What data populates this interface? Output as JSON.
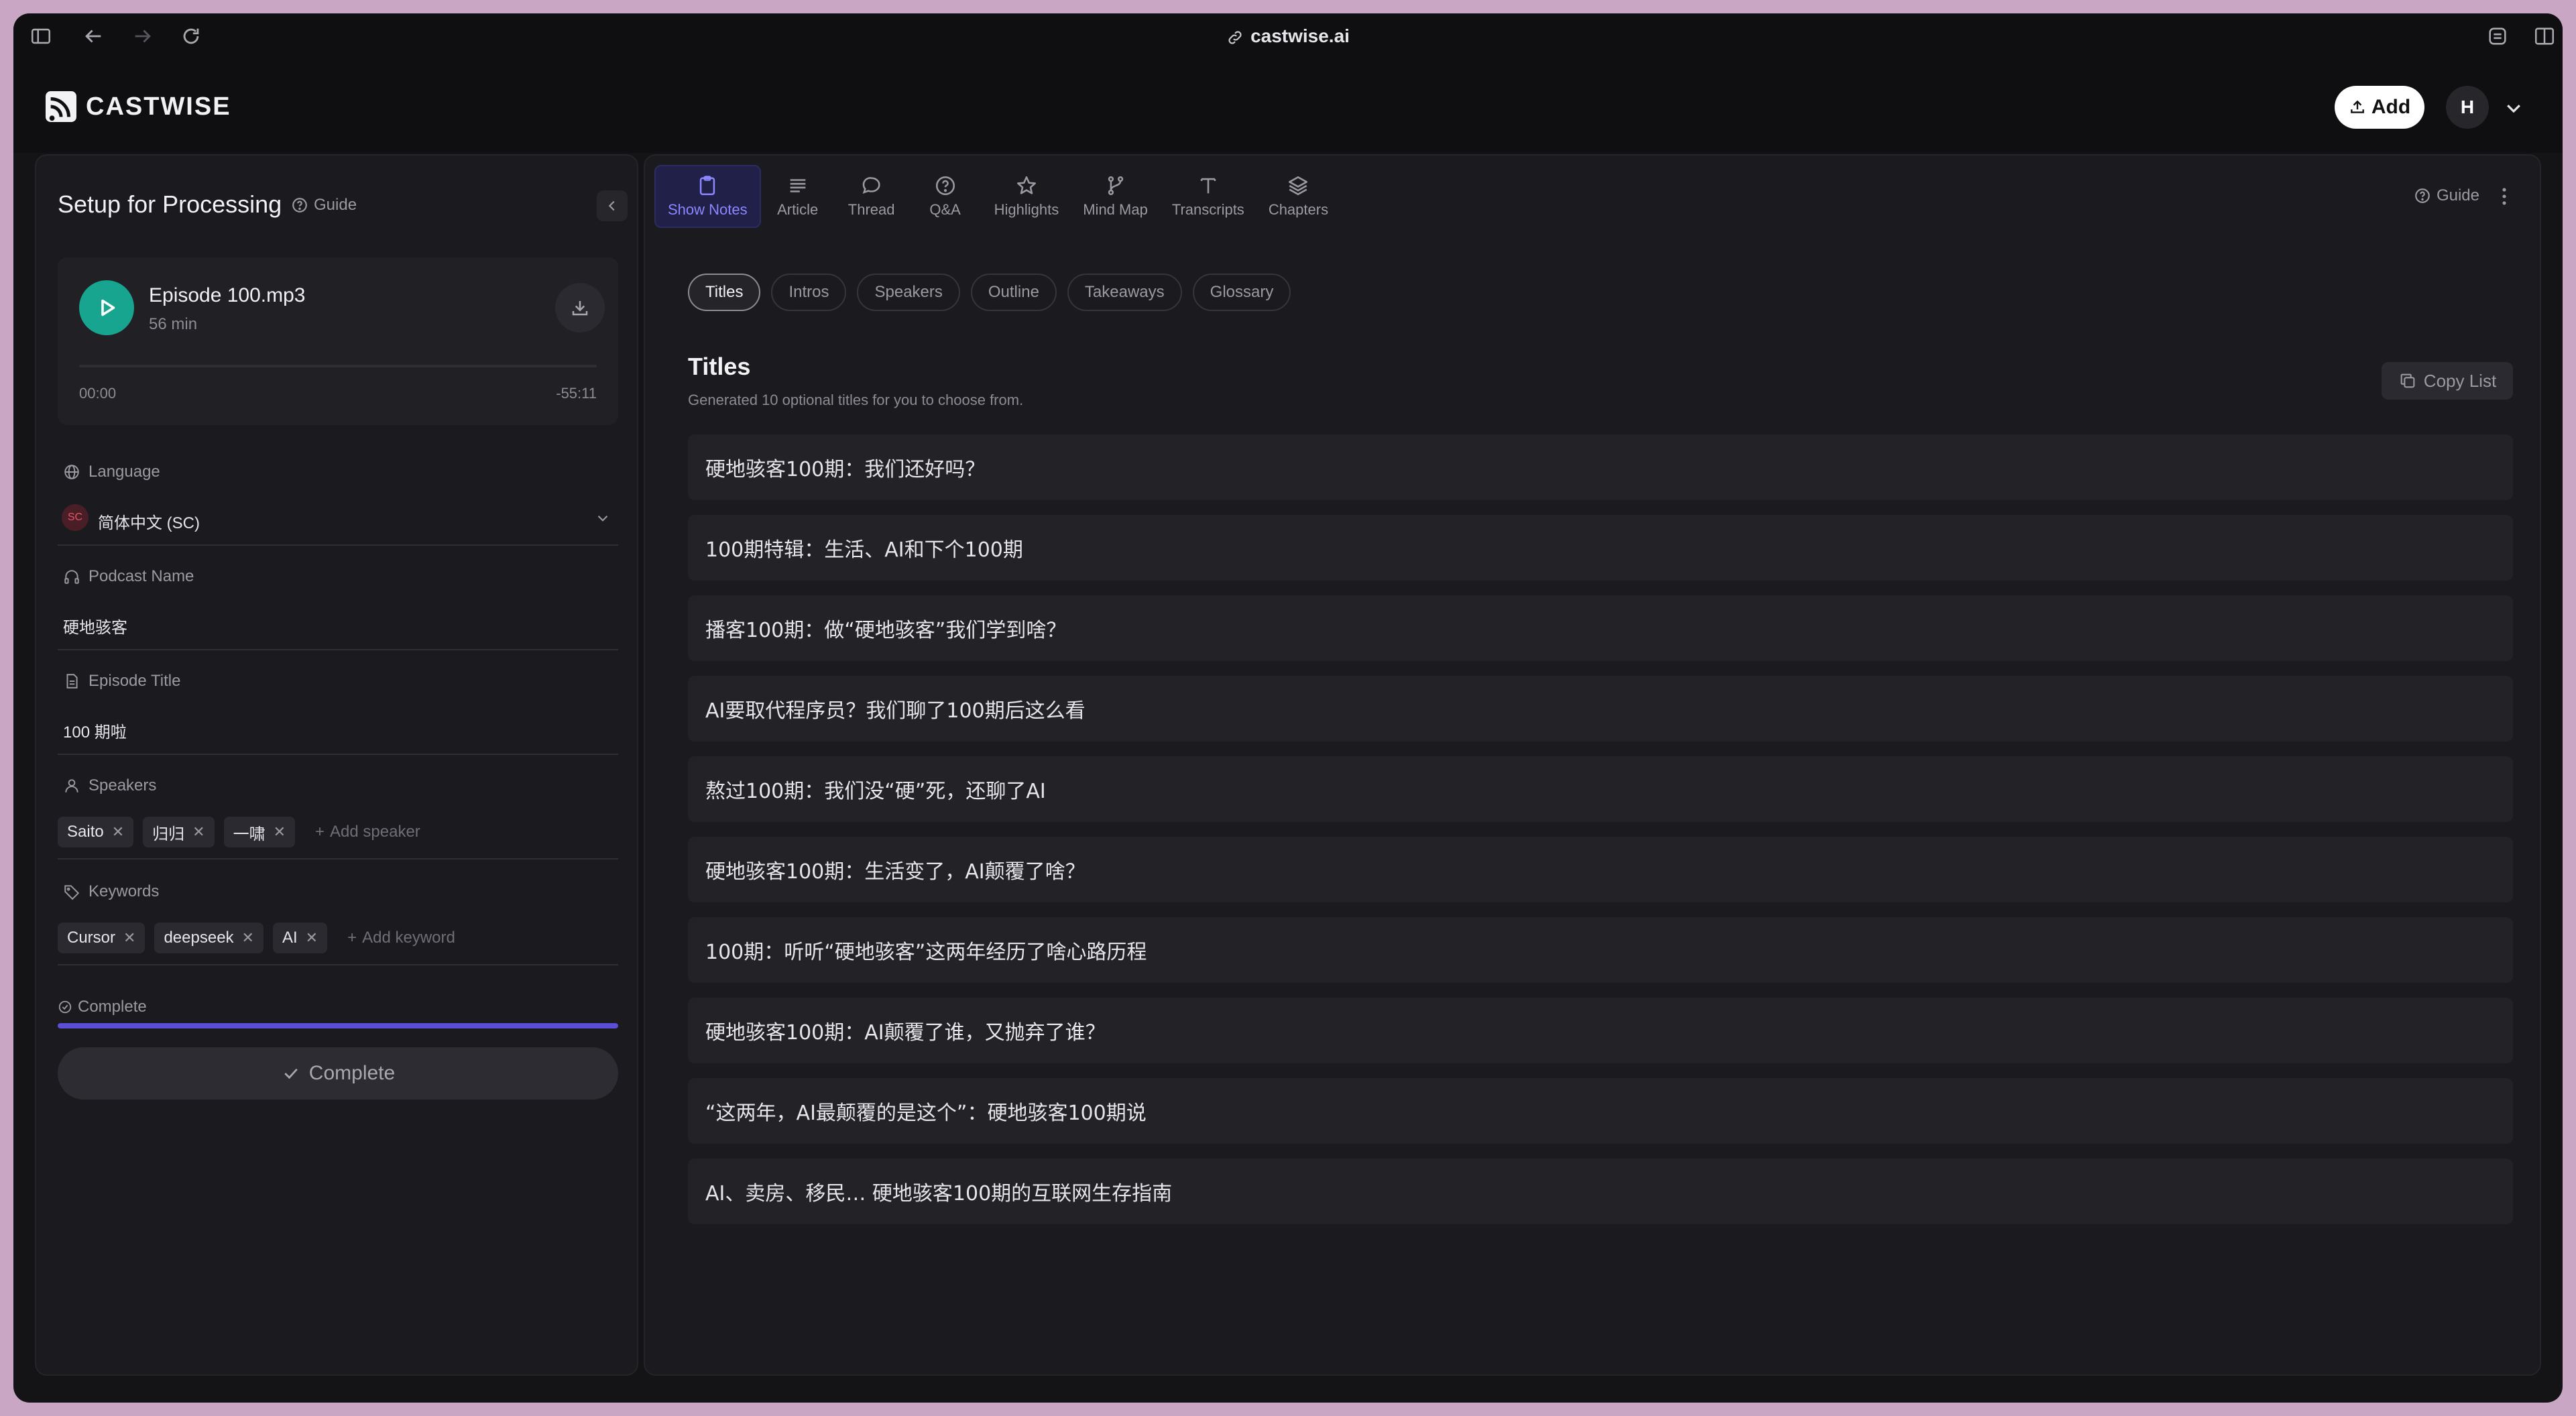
{
  "browser": {
    "url": "castwise.ai"
  },
  "header": {
    "logo_text": "CASTWISE",
    "add_label": "Add",
    "avatar_initial": "H"
  },
  "setup": {
    "title": "Setup for Processing",
    "guide_label": "Guide",
    "player": {
      "file_name": "Episode 100.mp3",
      "duration": "56 min",
      "time_start": "00:00",
      "time_end": "-55:11"
    },
    "language": {
      "label": "Language",
      "badge": "SC",
      "value": "简体中文 (SC)"
    },
    "podcast_name": {
      "label": "Podcast Name",
      "value": "硬地骇客"
    },
    "episode_title": {
      "label": "Episode Title",
      "value": "100 期啦"
    },
    "speakers": {
      "label": "Speakers",
      "items": [
        "Saito",
        "归归",
        "一啸"
      ],
      "add_label": "Add speaker"
    },
    "keywords": {
      "label": "Keywords",
      "items": [
        "Cursor",
        "deepseek",
        "AI"
      ],
      "add_label": "Add keyword"
    },
    "complete": {
      "label": "Complete",
      "progress": 1.0,
      "button_label": "Complete"
    }
  },
  "main": {
    "tabs": [
      {
        "label": "Show Notes",
        "icon": "clipboard-icon"
      },
      {
        "label": "Article",
        "icon": "lines-icon"
      },
      {
        "label": "Thread",
        "icon": "chat-bubble-icon"
      },
      {
        "label": "Q&A",
        "icon": "question-icon"
      },
      {
        "label": "Highlights",
        "icon": "star-icon"
      },
      {
        "label": "Mind Map",
        "icon": "branch-icon"
      },
      {
        "label": "Transcripts",
        "icon": "text-icon"
      },
      {
        "label": "Chapters",
        "icon": "layers-icon"
      }
    ],
    "active_tab": 0,
    "guide_label": "Guide",
    "subtabs": [
      "Titles",
      "Intros",
      "Speakers",
      "Outline",
      "Takeaways",
      "Glossary"
    ],
    "active_subtab": 0,
    "section_title": "Titles",
    "section_subtitle": "Generated 10 optional titles for you to choose from.",
    "copy_label": "Copy List",
    "titles": [
      "硬地骇客100期：我们还好吗？",
      "100期特辑：生活、AI和下个100期",
      "播客100期：做“硬地骇客”我们学到啥？",
      "AI要取代程序员？我们聊了100期后这么看",
      "熬过100期：我们没“硬”死，还聊了AI",
      "硬地骇客100期：生活变了，AI颠覆了啥？",
      "100期：听听“硬地骇客”这两年经历了啥心路历程",
      "硬地骇客100期：AI颠覆了谁，又抛弃了谁？",
      "“这两年，AI最颠覆的是这个”：硬地骇客100期说",
      "AI、卖房、移民… 硬地骇客100期的互联网生存指南"
    ]
  },
  "colors": {
    "accent": "#5b4fd6",
    "play": "#17a58f",
    "tab_active": "#8c86ff"
  }
}
